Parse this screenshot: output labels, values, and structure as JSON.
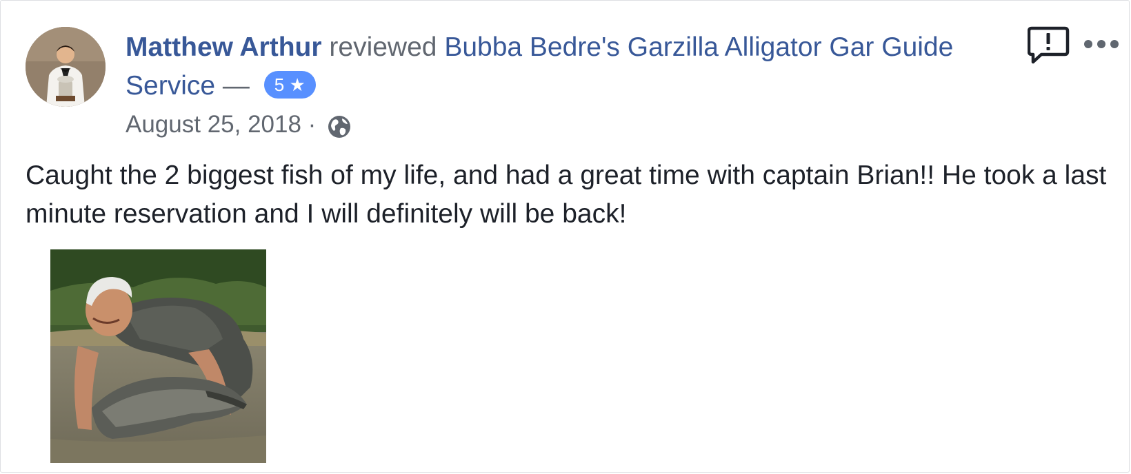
{
  "review": {
    "author": "Matthew Arthur",
    "action": "reviewed",
    "page_name": "Bubba Bedre's Garzilla Alligator Gar Guide Service",
    "separator": "—",
    "rating_value": "5",
    "rating_star": "★",
    "date": "August 25, 2018",
    "dot": "·",
    "privacy_icon": "globe-icon",
    "text": "Caught the 2 biggest fish of my life, and had a great time with captain Brian!! He took a last minute reservation and I will definitely will be back!"
  },
  "actions": {
    "report_icon": "report-speech-bubble-icon",
    "more_icon": "ellipsis-icon"
  },
  "colors": {
    "link": "#385898",
    "badge": "#5890ff",
    "secondary_text": "#616770",
    "primary_text": "#1d2129"
  }
}
